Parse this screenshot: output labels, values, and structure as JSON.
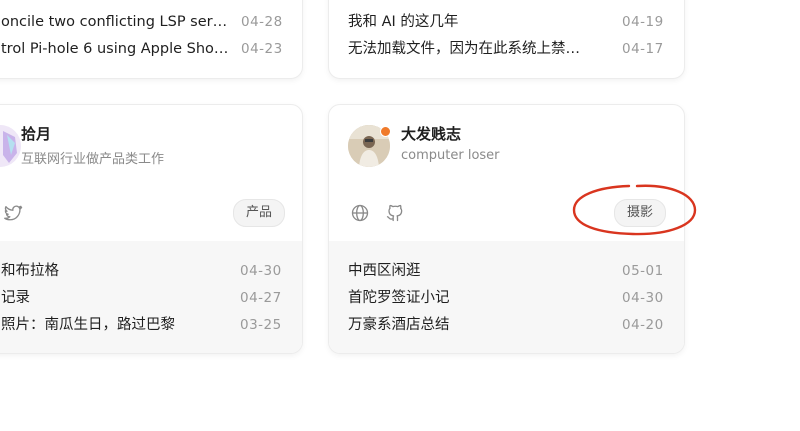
{
  "top_left_card": {
    "posts": [
      {
        "title": "oncile two conflicting LSP ser…",
        "date": "04-28"
      },
      {
        "title": "trol Pi-hole 6 using Apple Sho…",
        "date": "04-23"
      }
    ]
  },
  "top_right_card": {
    "posts": [
      {
        "title": "我和 AI 的这几年",
        "date": "04-19"
      },
      {
        "title": "无法加载文件，因为在此系统上禁…",
        "date": "04-17"
      }
    ]
  },
  "left_card": {
    "name": "拾月",
    "bio": "互联网行业做产品类工作",
    "icons": [
      "twitter-icon"
    ],
    "tag": "产品",
    "posts": [
      {
        "title": "和布拉格",
        "date": "04-30"
      },
      {
        "title": "记录",
        "date": "04-27"
      },
      {
        "title": "照片：南瓜生日，路过巴黎",
        "date": "03-25"
      }
    ]
  },
  "right_card": {
    "name": "大发贱志",
    "bio": "computer loser",
    "icons": [
      "globe-icon",
      "github-icon"
    ],
    "tag": "摄影",
    "posts": [
      {
        "title": "中西区闲逛",
        "date": "05-01"
      },
      {
        "title": "首陀罗签证小记",
        "date": "04-30"
      },
      {
        "title": "万豪系酒店总结",
        "date": "04-20"
      }
    ]
  },
  "colors": {
    "annotation": "#d9351f",
    "status_dot": "#f07a2a",
    "card_footer": "#f7f7f7"
  }
}
